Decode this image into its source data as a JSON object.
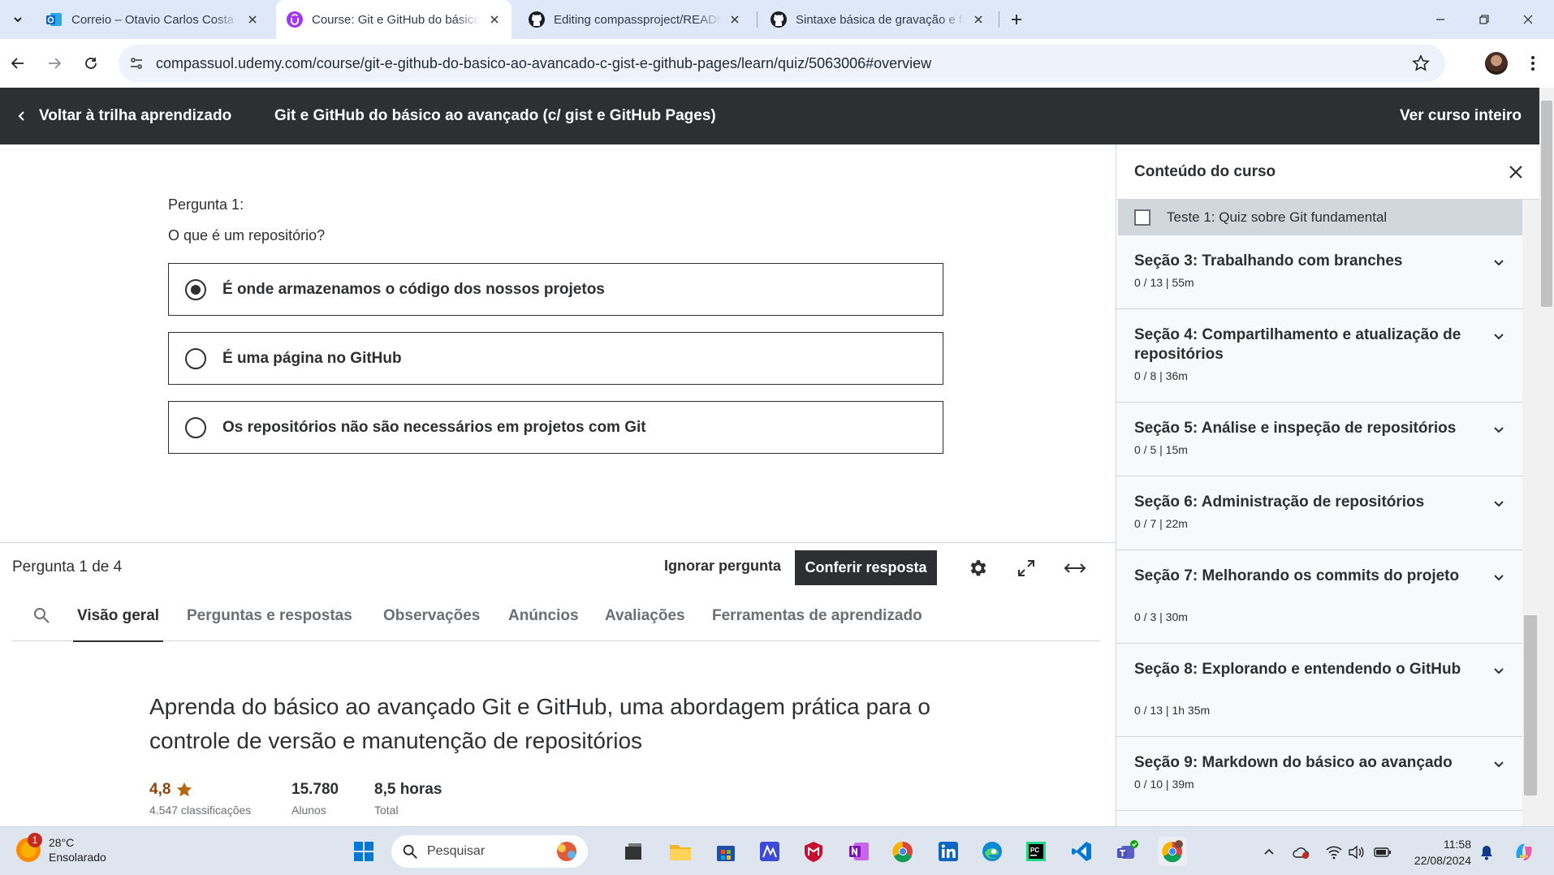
{
  "browser": {
    "tabs": [
      {
        "title": "Correio – Otavio Carlos Costa de Souza – Outlook",
        "icon": "outlook-icon",
        "active": false
      },
      {
        "title": "Course: Git e GitHub do básico ao avançado",
        "icon": "udemy-icon",
        "active": true
      },
      {
        "title": "Editing compassproject/README.md",
        "icon": "github-icon",
        "active": false
      },
      {
        "title": "Sintaxe básica de gravação e formatação",
        "icon": "github-icon",
        "active": false
      }
    ],
    "url": "compassuol.udemy.com/course/git-e-github-do-basico-ao-avancado-c-gist-e-github-pages/learn/quiz/5063006#overview"
  },
  "header": {
    "back_label": "Voltar à trilha aprendizado",
    "course_title": "Git e GitHub do básico ao avançado (c/ gist e GitHub Pages)",
    "full_course_label": "Ver curso inteiro"
  },
  "quiz": {
    "question_number": "Pergunta 1:",
    "question_text": "O que é um repositório?",
    "options": [
      {
        "text": "É onde armazenamos o código dos nossos projetos",
        "selected": true
      },
      {
        "text": "É uma página no GitHub",
        "selected": false
      },
      {
        "text": "Os repositórios não são necessários em projetos com Git",
        "selected": false
      }
    ],
    "progress": "Pergunta 1 de 4",
    "skip_label": "Ignorar pergunta",
    "check_label": "Conferir resposta"
  },
  "content_tabs": [
    {
      "label": "Visão geral",
      "active": true
    },
    {
      "label": "Perguntas e respostas",
      "active": false
    },
    {
      "label": "Observações",
      "active": false
    },
    {
      "label": "Anúncios",
      "active": false
    },
    {
      "label": "Avaliações",
      "active": false
    },
    {
      "label": "Ferramentas de aprendizado",
      "active": false
    }
  ],
  "overview": {
    "title": "Aprenda do básico ao avançado Git e GitHub, uma abordagem prática para o controle de versão e manutenção de repositórios",
    "rating": "4,8",
    "rating_label": "4.547 classificações",
    "students": "15.780",
    "students_label": "Alunos",
    "hours": "8,5 horas",
    "hours_label": "Total"
  },
  "sidebar": {
    "title": "Conteúdo do curso",
    "quiz_item": "Teste 1: Quiz sobre Git fundamental",
    "sections": [
      {
        "title": "Seção 3: Trabalhando com branches",
        "meta": "0 / 13 | 55m"
      },
      {
        "title": "Seção 4: Compartilhamento e atualização de repositórios",
        "meta": "0 / 8 | 36m"
      },
      {
        "title": "Seção 5: Análise e inspeção de repositórios",
        "meta": "0 / 5 | 15m"
      },
      {
        "title": "Seção 6: Administração de repositórios",
        "meta": "0 / 7 | 22m"
      },
      {
        "title": "Seção 7: Melhorando os commits do projeto",
        "meta": "0 / 3 | 30m"
      },
      {
        "title": "Seção 8: Explorando e entendendo o GitHub",
        "meta": "0 / 13 | 1h 35m"
      },
      {
        "title": "Seção 9: Markdown do básico ao avançado",
        "meta": "0 / 10 | 39m"
      }
    ]
  },
  "taskbar": {
    "weather_temp": "28°C",
    "weather_desc": "Ensolarado",
    "weather_badge": "1",
    "search_placeholder": "Pesquisar",
    "time": "11:58",
    "date": "22/08/2024"
  },
  "colors": {
    "header_bg": "#2d2f31",
    "tabbar_bg": "#dee8f8",
    "rating": "#b4690e",
    "taskbar_bg": "#dfe5ee"
  }
}
